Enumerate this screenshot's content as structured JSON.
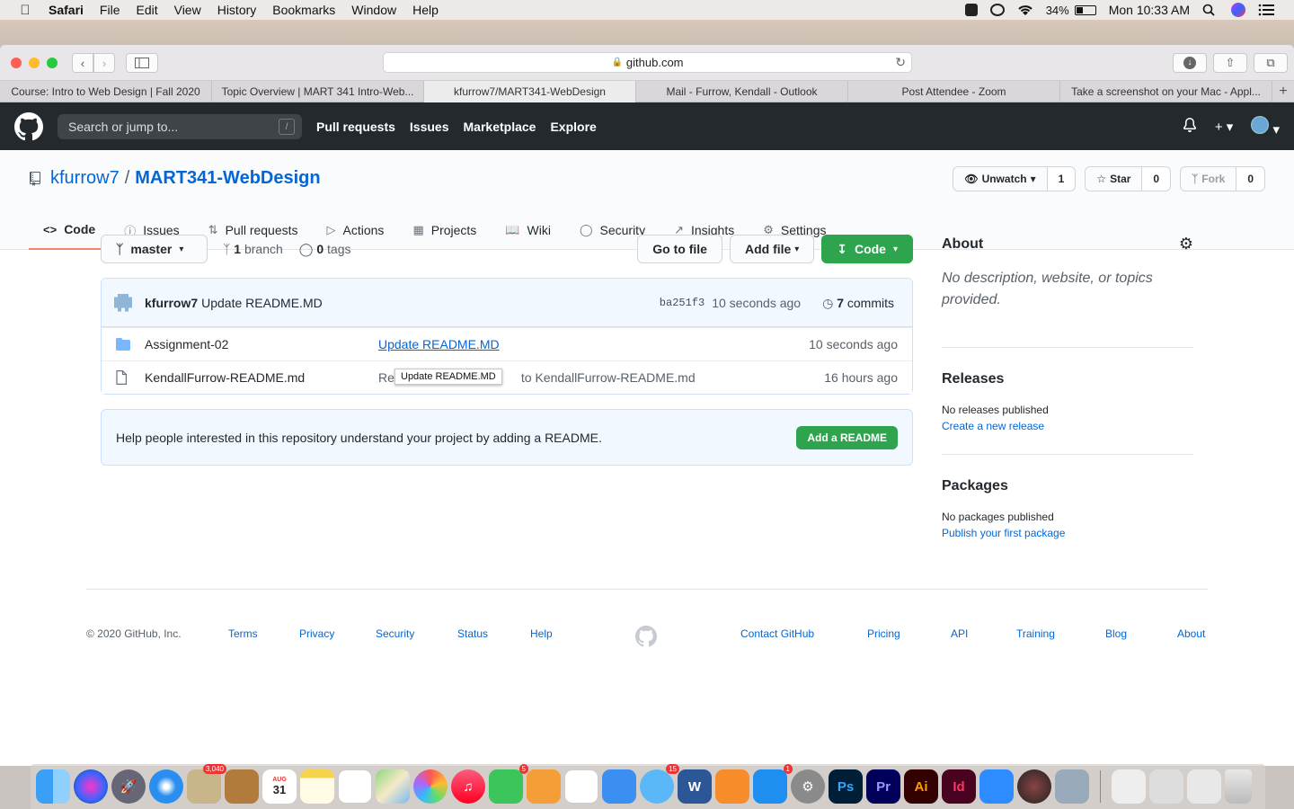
{
  "menubar": {
    "app": "Safari",
    "items": [
      "File",
      "Edit",
      "View",
      "History",
      "Bookmarks",
      "Window",
      "Help"
    ],
    "battery": "34%",
    "clock": "Mon 10:33 AM"
  },
  "browser": {
    "url": "github.com",
    "tabs": [
      "Course: Intro to Web Design | Fall 2020",
      "Topic Overview | MART 341 Intro-Web...",
      "kfurrow7/MART341-WebDesign",
      "Mail - Furrow, Kendall - Outlook",
      "Post Attendee - Zoom",
      "Take a screenshot on your Mac - Appl..."
    ]
  },
  "gh_header": {
    "search_placeholder": "Search or jump to...",
    "search_key": "/",
    "nav": [
      "Pull requests",
      "Issues",
      "Marketplace",
      "Explore"
    ]
  },
  "repo": {
    "owner": "kfurrow7",
    "sep": "/",
    "name": "MART341-WebDesign",
    "unwatch_label": "Unwatch",
    "watch_count": "1",
    "star_label": "Star",
    "star_count": "0",
    "fork_label": "Fork",
    "fork_count": "0",
    "tabs": [
      "Code",
      "Issues",
      "Pull requests",
      "Actions",
      "Projects",
      "Wiki",
      "Security",
      "Insights",
      "Settings"
    ]
  },
  "file_nav": {
    "branch": "master",
    "branch_count": "1",
    "branch_word": "branch",
    "tag_count": "0",
    "tag_word": "tags",
    "go_to_file": "Go to file",
    "add_file": "Add file",
    "code": "Code"
  },
  "commit": {
    "author": "kfurrow7",
    "message": "Update README.MD",
    "sha": "ba251f3",
    "time": "10 seconds ago",
    "commit_count": "7",
    "commit_word": "commits"
  },
  "files": [
    {
      "name": "Assignment-02",
      "message": "Update README.MD",
      "time": "10 seconds ago"
    },
    {
      "name": "KendallFurrow-README.md",
      "message_prefix": "Re",
      "message_suffix": "to KendallFurrow-README.md",
      "time": "16 hours ago"
    }
  ],
  "tooltip": "Update README.MD",
  "readme_banner": {
    "text": "Help people interested in this repository understand your project by adding a README.",
    "button": "Add a README"
  },
  "sidebar": {
    "about_title": "About",
    "about_desc": "No description, website, or topics provided.",
    "releases_title": "Releases",
    "releases_text": "No releases published",
    "releases_link": "Create a new release",
    "packages_title": "Packages",
    "packages_text": "No packages published",
    "packages_link": "Publish your first package"
  },
  "footer": {
    "copyright": "© 2020 GitHub, Inc.",
    "left_links": [
      "Terms",
      "Privacy",
      "Security",
      "Status",
      "Help"
    ],
    "right_links": [
      "Contact GitHub",
      "Pricing",
      "API",
      "Training",
      "Blog",
      "About"
    ]
  },
  "dock": {
    "badges": {
      "mail": "3,040",
      "calendar_month": "AUG",
      "calendar_day": "31",
      "facetime": "5",
      "messages": "15",
      "appstore": "1"
    },
    "labels": {
      "photoshop": "Ps",
      "premiere": "Pr",
      "illustrator": "Ai",
      "indesign": "Id"
    }
  }
}
